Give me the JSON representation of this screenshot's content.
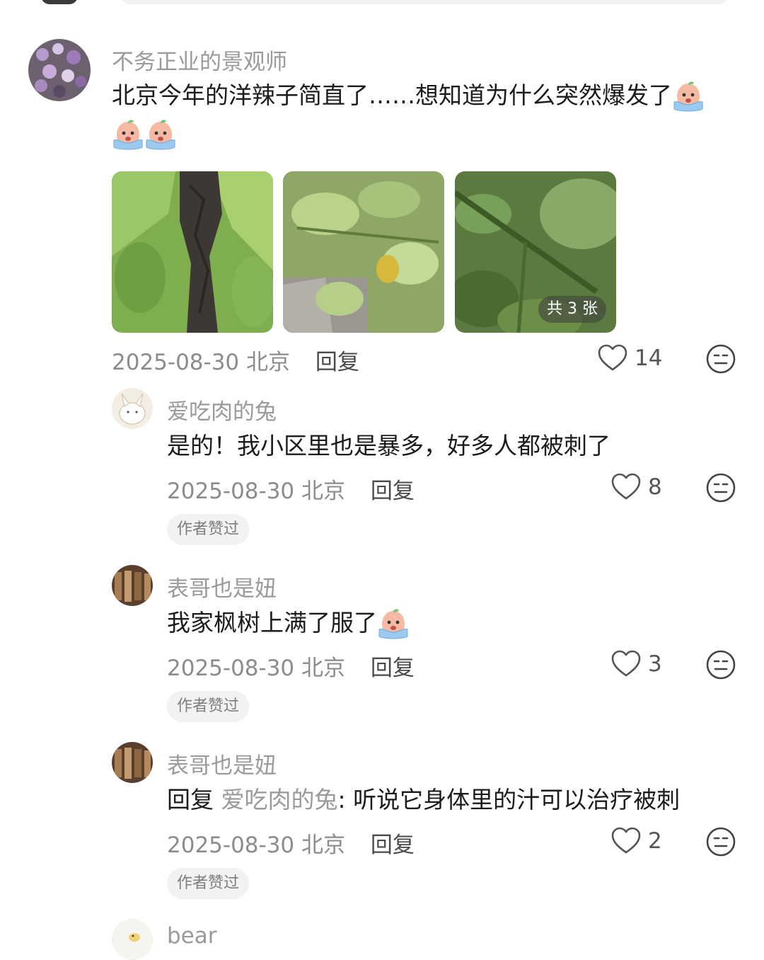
{
  "comments": [
    {
      "username": "不务正业的景观师",
      "text_line1": "北京今年的洋辣子简直了……想知道为什么突然爆发了",
      "date": "2025-08-30",
      "location": "北京",
      "reply_label": "回复",
      "likes": "14",
      "photo_count_label": "共 3 张"
    },
    {
      "username": "爱吃肉的兔",
      "text": "是的！我小区里也是暴多，好多人都被刺了",
      "date": "2025-08-30",
      "location": "北京",
      "reply_label": "回复",
      "likes": "8",
      "badge": "作者赞过"
    },
    {
      "username": "表哥也是妞",
      "text": "我家枫树上满了服了",
      "date": "2025-08-30",
      "location": "北京",
      "reply_label": "回复",
      "likes": "3",
      "badge": "作者赞过"
    },
    {
      "username": "表哥也是妞",
      "reply_prefix": "回复",
      "reply_to": "爱吃肉的兔",
      "text": ": 听说它身体里的汁可以治疗被刺",
      "date": "2025-08-30",
      "location": "北京",
      "reply_label": "回复",
      "likes": "2",
      "badge": "作者赞过"
    },
    {
      "username": "bear"
    }
  ],
  "icons": {
    "like": "heart-outline-icon",
    "dislike": "neutral-face-icon",
    "emoji": "crying-peach-emoji"
  },
  "colors": {
    "username": "#9a9a9a",
    "text": "#1c1c1c",
    "meta": "#8c8c8c",
    "badge_bg": "#f2f2f2"
  }
}
